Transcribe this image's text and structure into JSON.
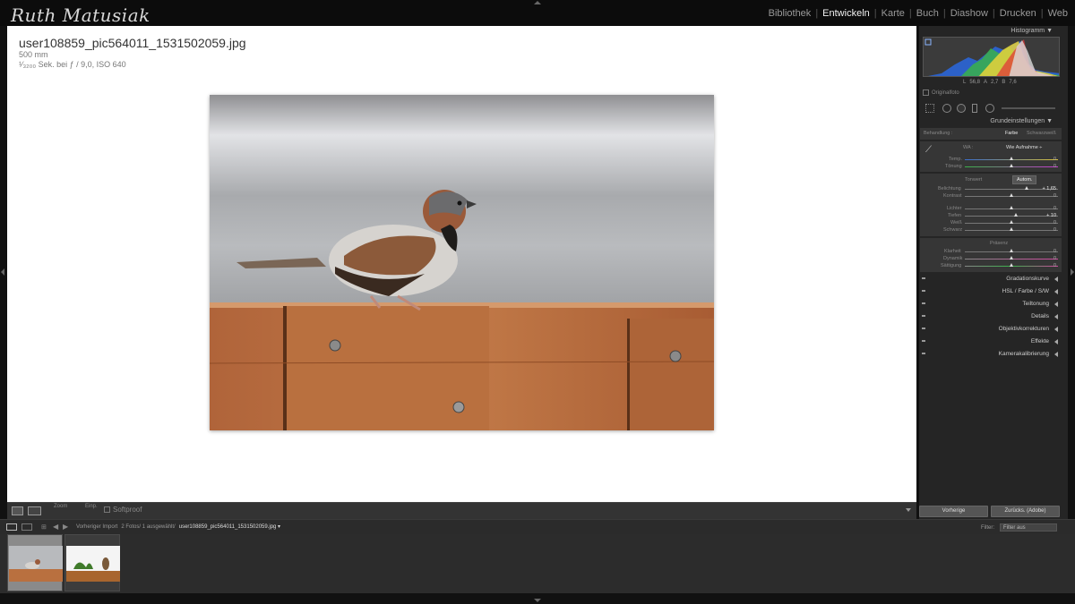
{
  "app": {
    "identity_plate": "Ruth Matusiak",
    "modules": [
      "Bibliothek",
      "Entwickeln",
      "Karte",
      "Buch",
      "Diashow",
      "Drucken",
      "Web"
    ],
    "active_module": "Entwickeln"
  },
  "photo_info": {
    "filename": "user108859_pic564011_1531502059.jpg",
    "focal_length": "500 mm",
    "exposure": "¹⁄₃₂₀₀ Sek. bei ƒ / 9,0, ISO 640"
  },
  "toolbar": {
    "zoom_label": "Zoom",
    "einp_label": "Einp.",
    "softproof_label": "Softproof"
  },
  "right_panel": {
    "histogram_title": "Histogramm",
    "histogram_values": {
      "L_label": "L",
      "L": "56,8",
      "A_label": "A",
      "A": "2,7",
      "B_label": "B",
      "B": "7,6"
    },
    "original_photo_label": "Originalfoto",
    "basic": {
      "title": "Grundeinstellungen",
      "treatment_label": "Behandlung :",
      "treatment_color": "Farbe",
      "treatment_bw": "Schwarzweiß",
      "wb_label": "WA :",
      "wb_value": "Wie Aufnahme ÷",
      "temp_label": "Temp.",
      "temp_value": "0",
      "tint_label": "Tönung",
      "tint_value": "0",
      "tone_label": "Tonwert",
      "auto_label": "Autom.",
      "exposure_label": "Belichtung",
      "exposure_value": "+ 1,65",
      "contrast_label": "Kontrast",
      "contrast_value": "0",
      "highlights_label": "Lichter",
      "highlights_value": "0",
      "shadows_label": "Tiefen",
      "shadows_value": "+ 10",
      "whites_label": "Weiß",
      "whites_value": "0",
      "blacks_label": "Schwarz",
      "blacks_value": "0",
      "presence_label": "Präsenz",
      "clarity_label": "Klarheit",
      "clarity_value": "0",
      "vibrance_label": "Dynamik",
      "vibrance_value": "0",
      "saturation_label": "Sättigung",
      "saturation_value": "0"
    },
    "collapsed_sections": [
      "Gradationskurve",
      "HSL / Farbe / S/W",
      "Teiltonung",
      "Details",
      "Objektivkorrekturen",
      "Effekte",
      "Kamerakalibrierung"
    ],
    "previous_button": "Vorherige",
    "reset_button": "Zurücks. (Adobe)"
  },
  "filmstrip": {
    "source": "Vorheriger Import",
    "count": "2 Fotos/ 1 ausgewählt/",
    "selected_file": "user108859_pic564011_1531502059.jpg ▾",
    "filter_label": "Filter:",
    "filter_value": "Filter aus"
  },
  "sliders": {
    "temp": 0.5,
    "tint": 0.5,
    "exposure": 0.66,
    "contrast": 0.5,
    "highlights": 0.5,
    "shadows": 0.55,
    "whites": 0.5,
    "blacks": 0.5,
    "clarity": 0.5,
    "vibrance": 0.5,
    "saturation": 0.5
  }
}
